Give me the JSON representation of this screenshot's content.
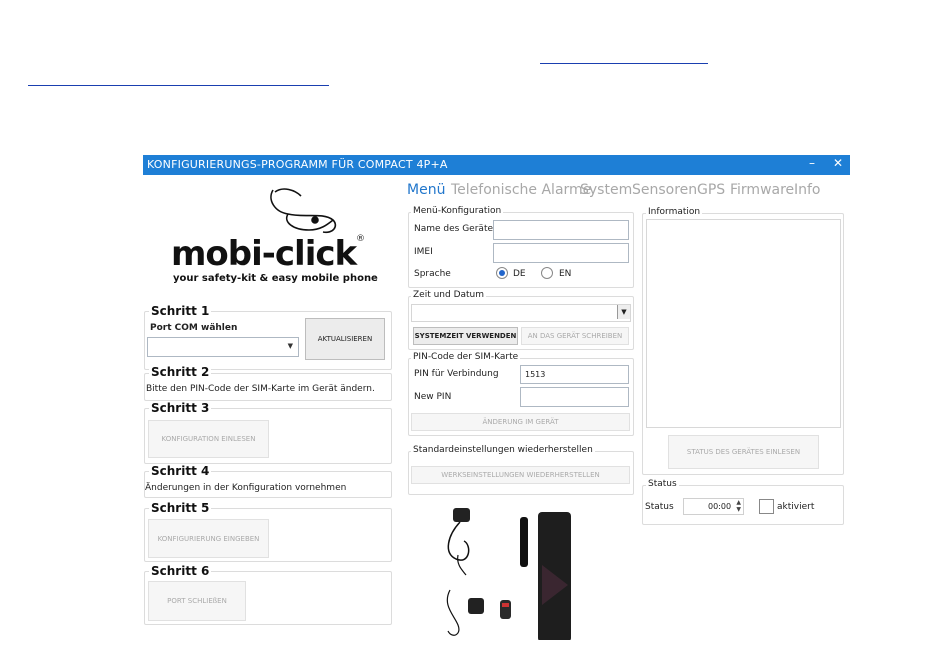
{
  "window": {
    "title": "KONFIGURIERUNGS-PROGRAMM FÜR COMPACT 4P+A",
    "minimize": "–",
    "close": "✕"
  },
  "logo": {
    "brand": "mobi-click",
    "tagline": "your safety-kit & easy mobile phone",
    "reg": "®"
  },
  "steps": [
    {
      "title": "Schritt 1",
      "label": "Port COM wählen",
      "button": "AKTUALISIEREN"
    },
    {
      "title": "Schritt 2",
      "text": "Bitte den PIN-Code der SIM-Karte im Gerät ändern."
    },
    {
      "title": "Schritt 3",
      "button": "KONFIGURATION EINLESEN"
    },
    {
      "title": "Schritt 4",
      "text": "Änderungen in der Konfiguration vornehmen"
    },
    {
      "title": "Schritt 5",
      "button": "KONFIGURIERUNG EINGEBEN"
    },
    {
      "title": "Schritt 6",
      "button": "PORT SCHLIEßEN"
    }
  ],
  "tabs": [
    "Menü",
    "Telefonische Alarme",
    "System",
    "Sensoren",
    "GPS",
    "Firmware",
    "Info"
  ],
  "menu_config": {
    "title": "Menü-Konfiguration",
    "device_name_label": "Name des Gerätes",
    "device_name_value": "",
    "imei_label": "IMEI",
    "imei_value": "",
    "language_label": "Sprache",
    "lang_de": "DE",
    "lang_en": "EN"
  },
  "datetime": {
    "title": "Zeit und Datum",
    "use_system_time": "SYSTEMZEIT VERWENDEN",
    "write_to_device": "AN DAS GERÄT SCHREIBEN"
  },
  "pin": {
    "title": "PIN-Code der SIM-Karte",
    "pin_label": "PIN für Verbindung",
    "pin_value": "1513",
    "new_pin_label": "New PIN",
    "new_pin_value": "",
    "change_button": "ÄNDERUNG IM GERÄT"
  },
  "defaults": {
    "title": "Standardeinstellungen wiederherstellen",
    "restore_button": "WERKSEINSTELLUNGEN WIEDERHERSTELLEN"
  },
  "information": {
    "title": "Information",
    "read_status_button": "STATUS DES GERÄTES EINLESEN"
  },
  "status": {
    "title": "Status",
    "label": "Status",
    "time_value": "00:00",
    "activated_label": "aktiviert"
  },
  "colors": {
    "titlebar": "#1e7fd6",
    "active_tab": "#2277cc",
    "inactive_tab": "#a8a8a8"
  }
}
